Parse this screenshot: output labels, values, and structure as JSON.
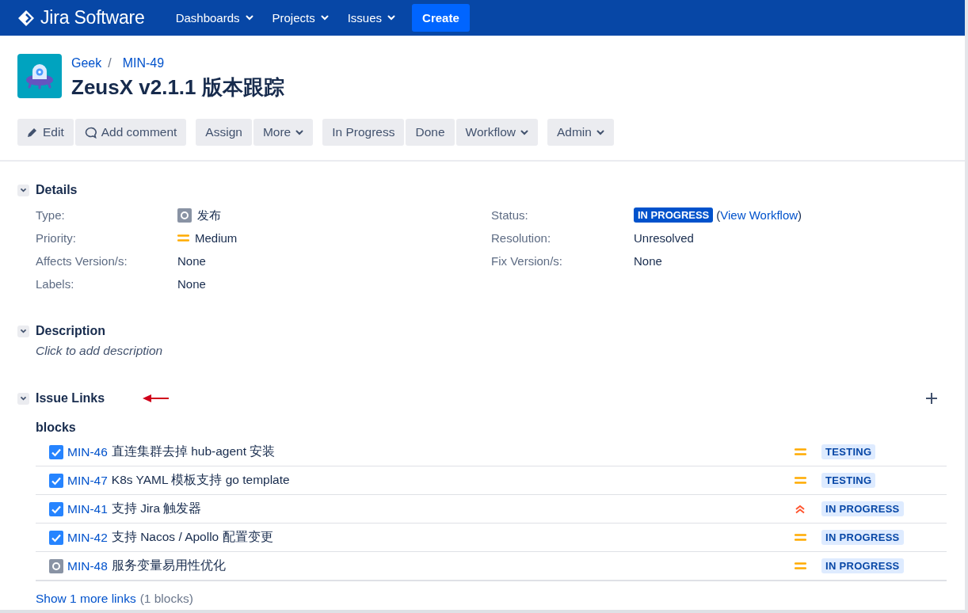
{
  "nav": {
    "product": "Jira Software",
    "items": [
      {
        "label": "Dashboards",
        "dropdown": true
      },
      {
        "label": "Projects",
        "dropdown": true
      },
      {
        "label": "Issues",
        "dropdown": true
      }
    ],
    "create": "Create"
  },
  "breadcrumbs": [
    "Geek",
    "MIN-49"
  ],
  "breadcrumb_separator": "/",
  "title": "ZeusX v2.1.1 版本跟踪",
  "toolbar": [
    [
      {
        "label": "Edit",
        "kind": "edit",
        "dropdown": false
      },
      {
        "label": "Add comment",
        "kind": "comment",
        "dropdown": false
      }
    ],
    [
      {
        "label": "Assign",
        "kind": "plain",
        "dropdown": false
      },
      {
        "label": "More",
        "kind": "plain",
        "dropdown": true
      }
    ],
    [
      {
        "label": "In Progress",
        "kind": "plain",
        "dropdown": false
      },
      {
        "label": "Done",
        "kind": "plain",
        "dropdown": false
      },
      {
        "label": "Workflow",
        "kind": "plain",
        "dropdown": true
      }
    ],
    [
      {
        "label": "Admin",
        "kind": "plain",
        "dropdown": true
      }
    ]
  ],
  "details": {
    "title": "Details",
    "expanded": true,
    "left": [
      {
        "label": "Type:",
        "value": "发布",
        "kind": "type"
      },
      {
        "label": "Priority:",
        "value": "Medium",
        "kind": "priority"
      },
      {
        "label": "Affects Version/s:",
        "value": "None",
        "kind": "plain"
      },
      {
        "label": "Labels:",
        "value": "None",
        "kind": "plain"
      }
    ],
    "right": [
      {
        "label": "Status:",
        "value": "IN PROGRESS",
        "kind": "status",
        "link_open": "(",
        "link": "View Workflow",
        "link_close": ")"
      },
      {
        "label": "Resolution:",
        "value": "Unresolved",
        "kind": "plain"
      },
      {
        "label": "Fix Version/s:",
        "value": "None",
        "kind": "plain"
      }
    ]
  },
  "description": {
    "title": "Description",
    "expanded": true,
    "placeholder": "Click to add description"
  },
  "issue_links": {
    "title": "Issue Links",
    "expanded": true,
    "group": "blocks",
    "rows": [
      {
        "key": "MIN-46",
        "summary": "直连集群去掉 hub-agent 安装",
        "type": {
          "kind": "task"
        },
        "priority": {
          "kind": "medium"
        },
        "status": "TESTING"
      },
      {
        "key": "MIN-47",
        "summary": "K8s YAML 模板支持 go template",
        "type": {
          "kind": "task"
        },
        "priority": {
          "kind": "medium"
        },
        "status": "TESTING"
      },
      {
        "key": "MIN-41",
        "summary": "支持 Jira 触发器",
        "type": {
          "kind": "task"
        },
        "priority": {
          "kind": "high"
        },
        "status": "IN PROGRESS"
      },
      {
        "key": "MIN-42",
        "summary": "支持 Nacos / Apollo 配置变更",
        "type": {
          "kind": "task"
        },
        "priority": {
          "kind": "medium"
        },
        "status": "IN PROGRESS"
      },
      {
        "key": "MIN-48",
        "summary": "服务变量易用性优化",
        "type": {
          "kind": "release"
        },
        "priority": {
          "kind": "medium"
        },
        "status": "IN PROGRESS"
      }
    ],
    "more_link": "Show 1 more links",
    "more_note": "(1 blocks)"
  }
}
